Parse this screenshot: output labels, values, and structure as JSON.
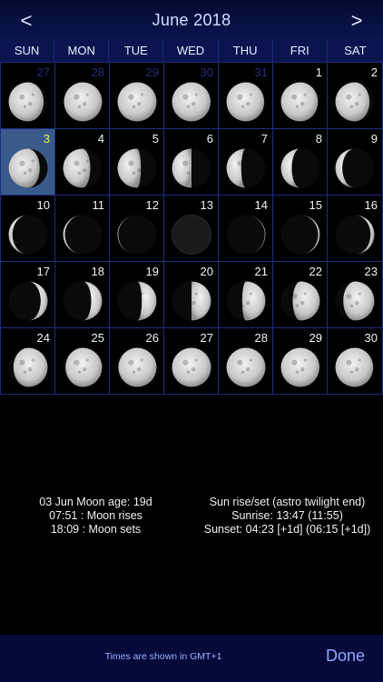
{
  "header": {
    "prev_label": "<",
    "next_label": ">",
    "title": "June 2018"
  },
  "weekdays": [
    "SUN",
    "MON",
    "TUE",
    "WED",
    "THU",
    "FRI",
    "SAT"
  ],
  "weeks": [
    [
      {
        "day": "27",
        "other": true,
        "illum": 0.9,
        "waxing": false
      },
      {
        "day": "28",
        "other": true,
        "illum": 0.98,
        "waxing": true
      },
      {
        "day": "29",
        "other": true,
        "illum": 1.0,
        "waxing": true
      },
      {
        "day": "30",
        "other": true,
        "illum": 0.99,
        "waxing": false
      },
      {
        "day": "31",
        "other": true,
        "illum": 0.97,
        "waxing": false
      },
      {
        "day": "1",
        "other": false,
        "illum": 0.95,
        "waxing": false
      },
      {
        "day": "2",
        "other": false,
        "illum": 0.88,
        "waxing": false
      }
    ],
    [
      {
        "day": "3",
        "other": false,
        "selected": true,
        "illum": 0.8,
        "waxing": false
      },
      {
        "day": "4",
        "other": false,
        "illum": 0.7,
        "waxing": false
      },
      {
        "day": "5",
        "other": false,
        "illum": 0.6,
        "waxing": false
      },
      {
        "day": "6",
        "other": false,
        "illum": 0.5,
        "waxing": false
      },
      {
        "day": "7",
        "other": false,
        "illum": 0.38,
        "waxing": false
      },
      {
        "day": "8",
        "other": false,
        "illum": 0.28,
        "waxing": false
      },
      {
        "day": "9",
        "other": false,
        "illum": 0.18,
        "waxing": false
      }
    ],
    [
      {
        "day": "10",
        "other": false,
        "illum": 0.1,
        "waxing": false
      },
      {
        "day": "11",
        "other": false,
        "illum": 0.05,
        "waxing": false
      },
      {
        "day": "12",
        "other": false,
        "illum": 0.02,
        "waxing": false
      },
      {
        "day": "13",
        "other": false,
        "illum": 0.0,
        "waxing": true
      },
      {
        "day": "14",
        "other": false,
        "illum": 0.02,
        "waxing": true
      },
      {
        "day": "15",
        "other": false,
        "illum": 0.05,
        "waxing": true
      },
      {
        "day": "16",
        "other": false,
        "illum": 0.1,
        "waxing": true
      }
    ],
    [
      {
        "day": "17",
        "other": false,
        "illum": 0.18,
        "waxing": true
      },
      {
        "day": "18",
        "other": false,
        "illum": 0.28,
        "waxing": true
      },
      {
        "day": "19",
        "other": false,
        "illum": 0.38,
        "waxing": true
      },
      {
        "day": "20",
        "other": false,
        "illum": 0.5,
        "waxing": true
      },
      {
        "day": "21",
        "other": false,
        "illum": 0.6,
        "waxing": true
      },
      {
        "day": "22",
        "other": false,
        "illum": 0.7,
        "waxing": true
      },
      {
        "day": "23",
        "other": false,
        "illum": 0.8,
        "waxing": true
      }
    ],
    [
      {
        "day": "24",
        "other": false,
        "illum": 0.88,
        "waxing": true
      },
      {
        "day": "25",
        "other": false,
        "illum": 0.94,
        "waxing": true
      },
      {
        "day": "26",
        "other": false,
        "illum": 0.98,
        "waxing": true
      },
      {
        "day": "27",
        "other": false,
        "illum": 1.0,
        "waxing": true
      },
      {
        "day": "28",
        "other": false,
        "illum": 1.0,
        "waxing": false
      },
      {
        "day": "29",
        "other": false,
        "illum": 0.99,
        "waxing": false
      },
      {
        "day": "30",
        "other": false,
        "illum": 0.97,
        "waxing": false
      }
    ]
  ],
  "moon_info": {
    "age_line": "03 Jun Moon age: 19d",
    "rise_line": "07:51 : Moon rises",
    "set_line": "18:09 : Moon sets"
  },
  "sun_info": {
    "title": "Sun rise/set (astro twilight end)",
    "sunrise": "Sunrise: 13:47 (11:55)",
    "sunset": "Sunset: 04:23 [+1d] (06:15 [+1d])"
  },
  "footer": {
    "note": "Times are shown in GMT+1",
    "done_label": "Done"
  },
  "colors": {
    "header_bg": "#0a1550",
    "grid_line": "#1d2e80",
    "selected_bg": "#3a5a8c",
    "selected_day_text": "#e8ef6a",
    "other_month_text": "#1f2f80",
    "done_text": "#8fa8ff"
  }
}
